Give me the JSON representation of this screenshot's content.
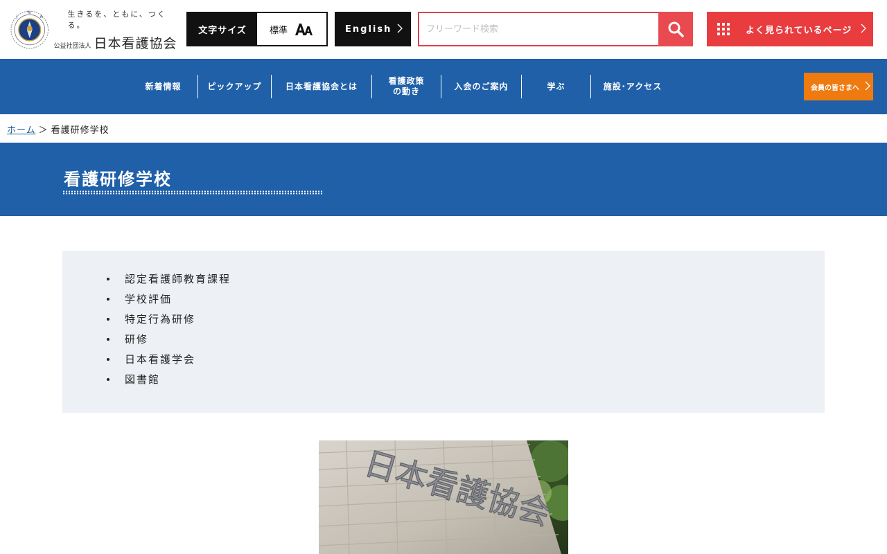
{
  "header": {
    "tagline": "生きるを、ともに、つくる。",
    "corp_type": "公益社団法人",
    "org_name": "日本看護協会",
    "emblem_icon": "nursing-association-emblem-icon",
    "font_size": {
      "label": "文字サイズ",
      "current": "標準",
      "icon": "font-size-aa-icon"
    },
    "english_label": "English",
    "search": {
      "placeholder": "フリーワード検索",
      "icon": "search-icon"
    },
    "popular_label": "よく見られているページ",
    "popular_icon": "grid-icon"
  },
  "nav": {
    "items": [
      {
        "label": "新着情報"
      },
      {
        "label": "ピックアップ"
      },
      {
        "label": "日本看護協会とは"
      },
      {
        "label": "看護政策\nの動き"
      },
      {
        "label": "入会のご案内"
      },
      {
        "label": "学ぶ"
      },
      {
        "label": "施設･アクセス"
      }
    ],
    "member_label": "会員の皆さまへ"
  },
  "breadcrumb": {
    "home": "ホーム",
    "separator": "＞",
    "current": "看護研修学校"
  },
  "page": {
    "title": "看護研修学校",
    "links": [
      "認定看護師教育課程",
      "学校評価",
      "特定行為研修",
      "研修",
      "日本看護学会",
      "図書館"
    ],
    "photo_sign_text": "日本看護協会"
  },
  "colors": {
    "brand_blue": "#2060a8",
    "accent_red": "#e83c3f",
    "member_orange": "#ee7a10",
    "box_bg": "#edf1f5"
  }
}
